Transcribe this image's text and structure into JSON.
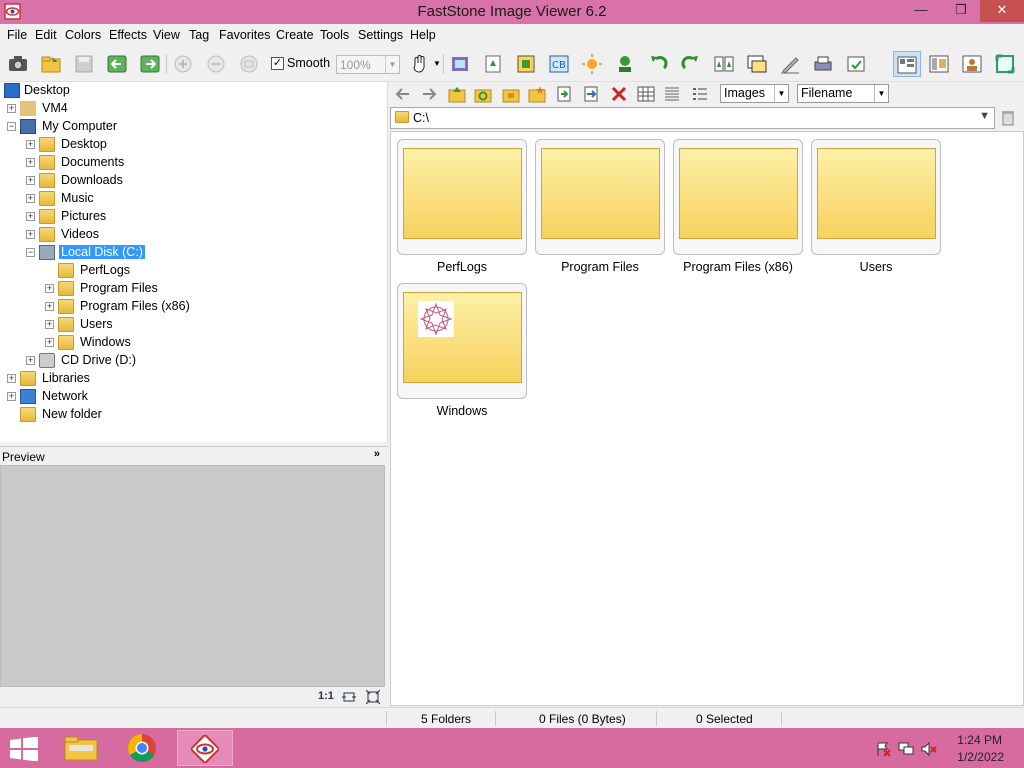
{
  "window": {
    "title": "FastStone Image Viewer 6.2",
    "minimize": "—",
    "restore": "❐",
    "close": "✕"
  },
  "menu": [
    "File",
    "Edit",
    "Colors",
    "Effects",
    "View",
    "Tag",
    "Favorites",
    "Create",
    "Tools",
    "Settings",
    "Help"
  ],
  "toolbar": {
    "smooth_label": "Smooth",
    "smooth_checked": "✓",
    "zoom_value": "100%"
  },
  "tree": {
    "desktop": "Desktop",
    "vm4": "VM4",
    "my_computer": "My Computer",
    "items": [
      "Desktop",
      "Documents",
      "Downloads",
      "Music",
      "Pictures",
      "Videos"
    ],
    "local_disk": "Local Disk (C:)",
    "subfolders": [
      "PerfLogs",
      "Program Files",
      "Program Files (x86)",
      "Users",
      "Windows"
    ],
    "cd_drive": "CD Drive (D:)",
    "libraries": "Libraries",
    "network": "Network",
    "new_folder": "New folder"
  },
  "preview": {
    "label": "Preview",
    "ratio": "1:1"
  },
  "filters": {
    "type": "Images",
    "sort": "Filename"
  },
  "path": "C:\\",
  "thumbnails": [
    "PerfLogs",
    "Program Files",
    "Program Files (x86)",
    "Users",
    "Windows"
  ],
  "status": {
    "folders": "5 Folders",
    "files": "0 Files (0 Bytes)",
    "selected": "0 Selected"
  },
  "taskbar": {
    "time": "1:24 PM",
    "date": "1/2/2022"
  },
  "colors": {
    "titlebar": "#d972a9",
    "taskbar": "#d76a9f",
    "selection": "#3399ff",
    "folder": "#f7d25c"
  }
}
